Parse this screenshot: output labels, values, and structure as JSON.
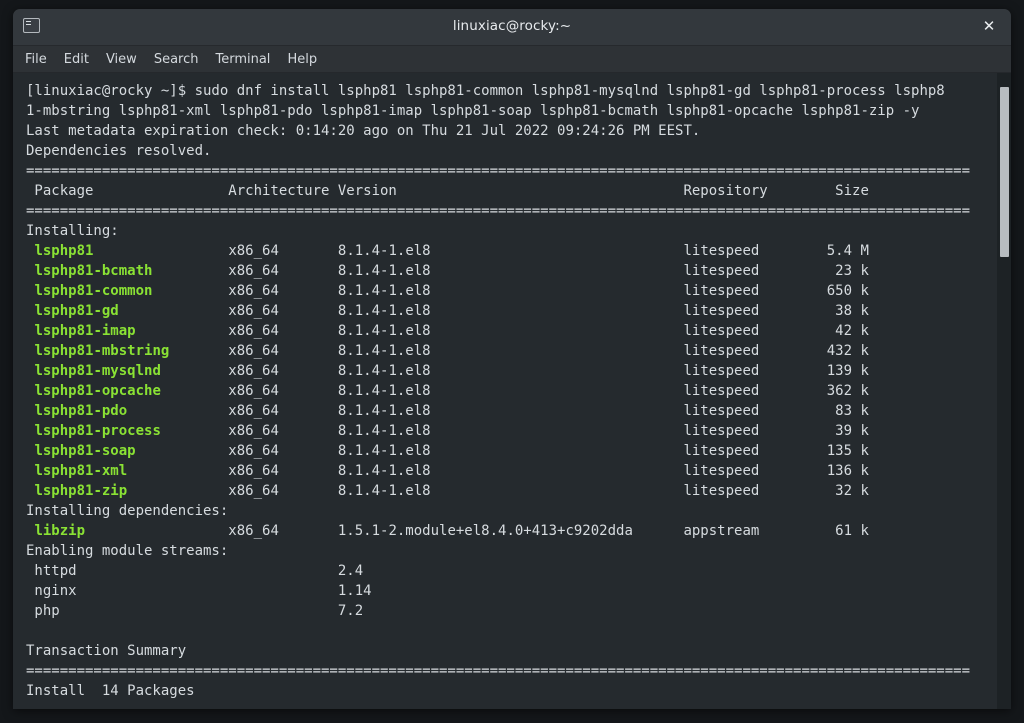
{
  "window": {
    "title": "linuxiac@rocky:~",
    "close_label": "✕",
    "icon": "terminal-icon"
  },
  "menu": {
    "items": [
      "File",
      "Edit",
      "View",
      "Search",
      "Terminal",
      "Help"
    ]
  },
  "terminal": {
    "prompt_line_1": "[linuxiac@rocky ~]$ sudo dnf install lsphp81 lsphp81-common lsphp81-mysqlnd lsphp81-gd lsphp81-process lsphp8",
    "prompt_line_2": "1-mbstring lsphp81-xml lsphp81-pdo lsphp81-imap lsphp81-soap lsphp81-bcmath lsphp81-opcache lsphp81-zip -y",
    "metadata_line": "Last metadata expiration check: 0:14:20 ago on Thu 21 Jul 2022 09:24:26 PM EEST.",
    "deps_resolved": "Dependencies resolved.",
    "separator": "================================================================================================================",
    "headers": {
      "package": "Package",
      "architecture": "Architecture",
      "version": "Version",
      "repository": "Repository",
      "size": "Size"
    },
    "installing_label": "Installing:",
    "installing_deps_label": "Installing dependencies:",
    "enabling_modules_label": "Enabling module streams:",
    "transaction_summary_label": "Transaction Summary",
    "install_summary": "Install  14 Packages",
    "packages": [
      {
        "name": "lsphp81",
        "arch": "x86_64",
        "version": "8.1.4-1.el8",
        "repo": "litespeed",
        "size": "5.4 M"
      },
      {
        "name": "lsphp81-bcmath",
        "arch": "x86_64",
        "version": "8.1.4-1.el8",
        "repo": "litespeed",
        "size": "23 k"
      },
      {
        "name": "lsphp81-common",
        "arch": "x86_64",
        "version": "8.1.4-1.el8",
        "repo": "litespeed",
        "size": "650 k"
      },
      {
        "name": "lsphp81-gd",
        "arch": "x86_64",
        "version": "8.1.4-1.el8",
        "repo": "litespeed",
        "size": "38 k"
      },
      {
        "name": "lsphp81-imap",
        "arch": "x86_64",
        "version": "8.1.4-1.el8",
        "repo": "litespeed",
        "size": "42 k"
      },
      {
        "name": "lsphp81-mbstring",
        "arch": "x86_64",
        "version": "8.1.4-1.el8",
        "repo": "litespeed",
        "size": "432 k"
      },
      {
        "name": "lsphp81-mysqlnd",
        "arch": "x86_64",
        "version": "8.1.4-1.el8",
        "repo": "litespeed",
        "size": "139 k"
      },
      {
        "name": "lsphp81-opcache",
        "arch": "x86_64",
        "version": "8.1.4-1.el8",
        "repo": "litespeed",
        "size": "362 k"
      },
      {
        "name": "lsphp81-pdo",
        "arch": "x86_64",
        "version": "8.1.4-1.el8",
        "repo": "litespeed",
        "size": "83 k"
      },
      {
        "name": "lsphp81-process",
        "arch": "x86_64",
        "version": "8.1.4-1.el8",
        "repo": "litespeed",
        "size": "39 k"
      },
      {
        "name": "lsphp81-soap",
        "arch": "x86_64",
        "version": "8.1.4-1.el8",
        "repo": "litespeed",
        "size": "135 k"
      },
      {
        "name": "lsphp81-xml",
        "arch": "x86_64",
        "version": "8.1.4-1.el8",
        "repo": "litespeed",
        "size": "136 k"
      },
      {
        "name": "lsphp81-zip",
        "arch": "x86_64",
        "version": "8.1.4-1.el8",
        "repo": "litespeed",
        "size": "32 k"
      }
    ],
    "dependencies": [
      {
        "name": "libzip",
        "arch": "x86_64",
        "version": "1.5.1-2.module+el8.4.0+413+c9202dda",
        "repo": "appstream",
        "size": "61 k"
      }
    ],
    "module_streams": [
      {
        "name": "httpd",
        "version": "2.4"
      },
      {
        "name": "nginx",
        "version": "1.14"
      },
      {
        "name": "php",
        "version": "7.2"
      }
    ]
  },
  "colors": {
    "package_green": "#8ae234",
    "text_white": "#d6dbdf",
    "terminal_bg": "#252a2e",
    "titlebar_bg": "#33383d"
  }
}
